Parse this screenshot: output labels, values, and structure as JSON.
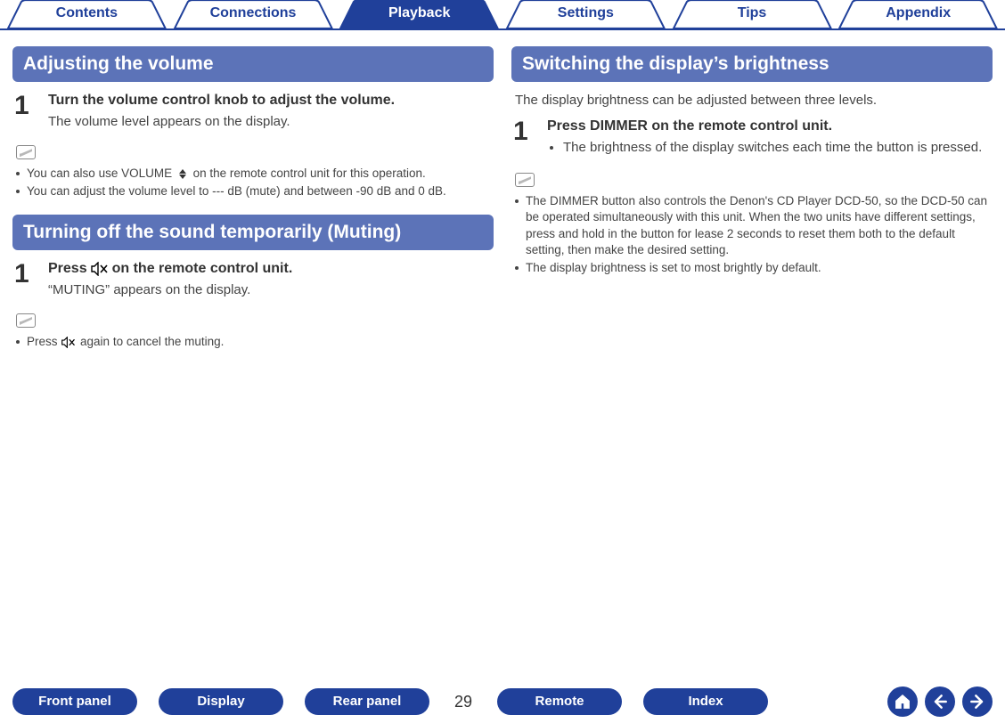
{
  "topnav": {
    "items": [
      "Contents",
      "Connections",
      "Playback",
      "Settings",
      "Tips",
      "Appendix"
    ],
    "activeIndex": 2
  },
  "left": {
    "section1": {
      "title": "Adjusting the volume",
      "step_num": "1",
      "step_title": "Turn the volume control knob to adjust the volume.",
      "step_desc": "The volume level appears on the display.",
      "tips": {
        "a_pre": "You can also use VOLUME ",
        "a_post": " on the remote control unit for this operation.",
        "b": "You can adjust the volume level to --- dB (mute) and between -90 dB and 0 dB."
      }
    },
    "section2": {
      "title": "Turning off the sound temporarily (Muting)",
      "step_num": "1",
      "step_title_pre": "Press ",
      "step_title_post": " on the remote control unit.",
      "step_desc": "“MUTING” appears on the display.",
      "tips": {
        "a_pre": "Press ",
        "a_post": " again to cancel the muting."
      }
    }
  },
  "right": {
    "section1": {
      "title": "Switching the display’s brightness",
      "intro": "The display brightness can be adjusted between three levels.",
      "step_num": "1",
      "step_title": "Press DIMMER on the remote control unit.",
      "step_bullet": "The brightness of the display switches each time the button is pressed.",
      "tips": {
        "a": "The DIMMER button also controls the Denon's CD Player DCD-50, so the DCD-50 can be operated simultaneously with this unit. When the two units have different settings, press and hold in the button for lease 2 seconds to reset them both to the default setting, then make the desired setting.",
        "b": "The display brightness is set to most brightly by default."
      }
    }
  },
  "bottomnav": {
    "items": [
      "Front panel",
      "Display",
      "Rear panel"
    ],
    "page": "29",
    "items2": [
      "Remote",
      "Index"
    ]
  }
}
